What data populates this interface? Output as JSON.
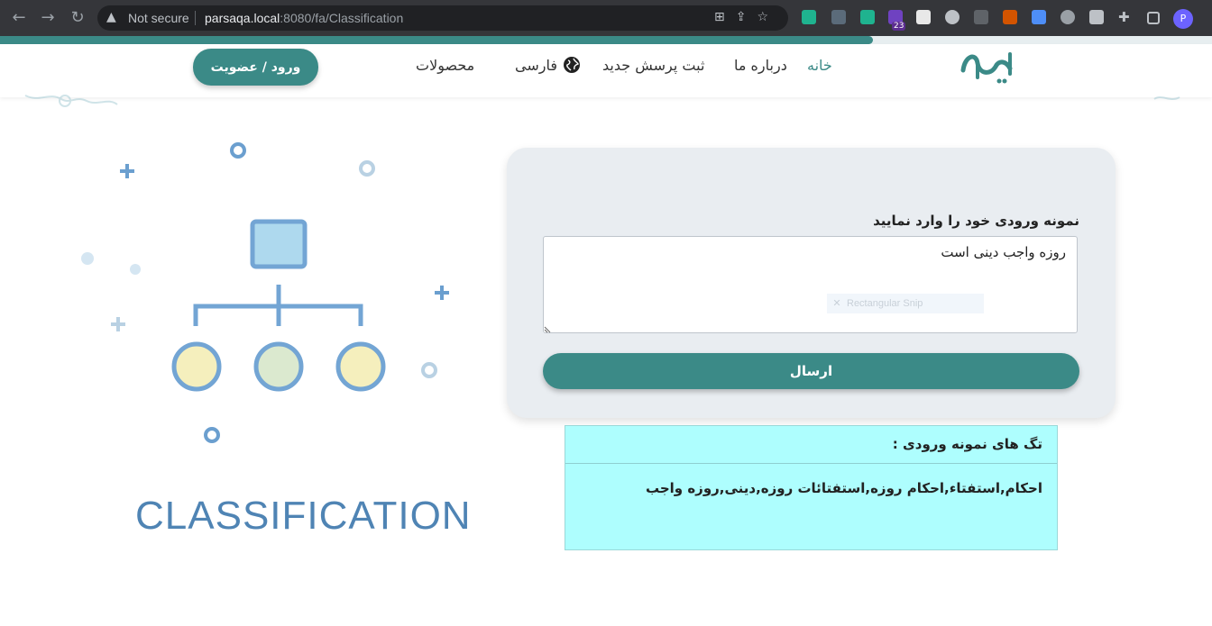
{
  "browser": {
    "security_label": "Not secure",
    "url_host": "parsaqa.local",
    "url_rest": ":8080/fa/Classification",
    "extension_badge": "23",
    "profile_initial": "P"
  },
  "progress": {
    "fraction": 0.72,
    "color": "#3b8a87"
  },
  "nav": {
    "home": "خانه",
    "about": "درباره ما",
    "new_question": "ثبت پرسش جدید",
    "language": "فارسی",
    "products": "محصولات",
    "login": "ورود / عضویت"
  },
  "illustration": {
    "title": "CLASSIFICATION"
  },
  "form": {
    "label": "نمونه ورودی خود را وارد نمایید",
    "input_value": "روزه واجب دینی است",
    "overlay_text": "Rectangular Snip",
    "submit": "ارسال"
  },
  "result": {
    "title": "تگ های نمونه ورودی :",
    "tags": "احکام,استفتاء,احکام روزه,استفتائات روزه,دینی,روزه واجب"
  },
  "colors": {
    "accent": "#3b8a87",
    "result_bg": "#aefefe",
    "card_bg": "#e9edf1",
    "illus_blue": "#73a5d4"
  }
}
